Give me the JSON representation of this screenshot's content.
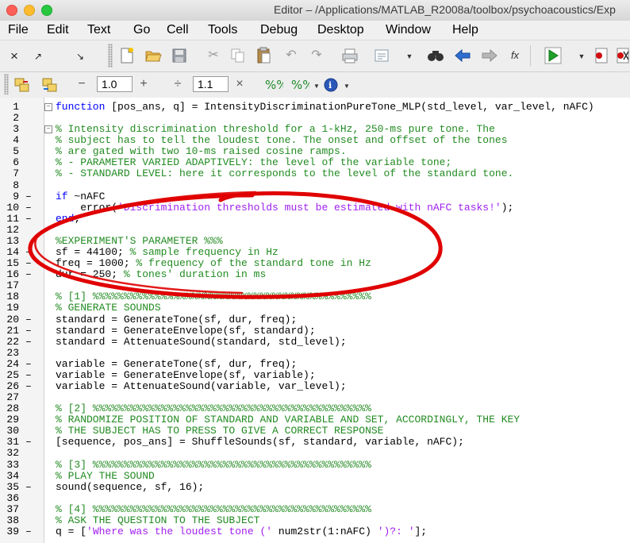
{
  "window": {
    "title": "Editor – /Applications/MATLAB_R2008a/toolbox/psychoacoustics/Exp"
  },
  "menu": [
    "File",
    "Edit",
    "Text",
    "Go",
    "Cell",
    "Tools",
    "Debug",
    "Desktop",
    "Window",
    "Help"
  ],
  "toolbar": {
    "zoom_value_1": "1.0",
    "zoom_value_2": "1.1",
    "minus": "−",
    "plus": "+",
    "divide": "÷",
    "times": "×"
  },
  "code_lines": [
    {
      "n": "1",
      "dash": "",
      "fold": "−",
      "segs": [
        [
          "kw",
          "function"
        ],
        [
          "plain",
          " [pos_ans, q] = IntensityDiscriminationPureTone_MLP(std_level, var_level, nAFC)"
        ]
      ]
    },
    {
      "n": "2",
      "dash": "",
      "fold": "",
      "segs": []
    },
    {
      "n": "3",
      "dash": "",
      "fold": "−",
      "segs": [
        [
          "comment",
          "% Intensity discrimination threshold for a 1-kHz, 250-ms pure tone. The"
        ]
      ]
    },
    {
      "n": "4",
      "dash": "",
      "fold": "",
      "segs": [
        [
          "comment",
          "% subject has to tell the loudest tone. The onset and offset of the tones"
        ]
      ]
    },
    {
      "n": "5",
      "dash": "",
      "fold": "",
      "segs": [
        [
          "comment",
          "% are gated with two 10-ms raised cosine ramps."
        ]
      ]
    },
    {
      "n": "6",
      "dash": "",
      "fold": "",
      "segs": [
        [
          "comment",
          "% - PARAMETER VARIED ADAPTIVELY: the level of the variable tone;"
        ]
      ]
    },
    {
      "n": "7",
      "dash": "",
      "fold": "",
      "segs": [
        [
          "comment",
          "% - STANDARD LEVEL: here it corresponds to the level of the standard tone."
        ]
      ]
    },
    {
      "n": "8",
      "dash": "",
      "fold": "",
      "segs": []
    },
    {
      "n": "9",
      "dash": "–",
      "fold": "",
      "segs": [
        [
          "kw",
          "if"
        ],
        [
          "plain",
          " ~nAFC"
        ]
      ]
    },
    {
      "n": "10",
      "dash": "–",
      "fold": "",
      "segs": [
        [
          "plain",
          "    error("
        ],
        [
          "str",
          "'Discrimination thresholds must be estimated with nAFC tasks!'"
        ],
        [
          "plain",
          ");"
        ]
      ]
    },
    {
      "n": "11",
      "dash": "–",
      "fold": "",
      "segs": [
        [
          "kw",
          "end"
        ],
        [
          "plain",
          ";"
        ]
      ]
    },
    {
      "n": "12",
      "dash": "",
      "fold": "",
      "segs": []
    },
    {
      "n": "13",
      "dash": "",
      "fold": "",
      "segs": [
        [
          "comment",
          "%EXPERIMENT'S PARAMETER %%%"
        ]
      ]
    },
    {
      "n": "14",
      "dash": "–",
      "fold": "",
      "segs": [
        [
          "plain",
          "sf = 44100; "
        ],
        [
          "comment",
          "% sample frequency in Hz"
        ]
      ]
    },
    {
      "n": "15",
      "dash": "–",
      "fold": "",
      "segs": [
        [
          "plain",
          "freq = 1000; "
        ],
        [
          "comment",
          "% frequency of the standard tone in Hz"
        ]
      ]
    },
    {
      "n": "16",
      "dash": "–",
      "fold": "",
      "segs": [
        [
          "plain",
          "dur = 250; "
        ],
        [
          "comment",
          "% tones' duration in ms"
        ]
      ]
    },
    {
      "n": "17",
      "dash": "",
      "fold": "",
      "segs": []
    },
    {
      "n": "18",
      "dash": "",
      "fold": "",
      "segs": [
        [
          "comment",
          "% [1] %%%%%%%%%%%%%%%%%%%%%%%%%%%%%%%%%%%%%%%%%%%%%"
        ]
      ]
    },
    {
      "n": "19",
      "dash": "",
      "fold": "",
      "segs": [
        [
          "comment",
          "% GENERATE SOUNDS"
        ]
      ]
    },
    {
      "n": "20",
      "dash": "–",
      "fold": "",
      "segs": [
        [
          "plain",
          "standard = GenerateTone(sf, dur, freq);"
        ]
      ]
    },
    {
      "n": "21",
      "dash": "–",
      "fold": "",
      "segs": [
        [
          "plain",
          "standard = GenerateEnvelope(sf, standard);"
        ]
      ]
    },
    {
      "n": "22",
      "dash": "–",
      "fold": "",
      "segs": [
        [
          "plain",
          "standard = AttenuateSound(standard, std_level);"
        ]
      ]
    },
    {
      "n": "23",
      "dash": "",
      "fold": "",
      "segs": []
    },
    {
      "n": "24",
      "dash": "–",
      "fold": "",
      "segs": [
        [
          "plain",
          "variable = GenerateTone(sf, dur, freq);"
        ]
      ]
    },
    {
      "n": "25",
      "dash": "–",
      "fold": "",
      "segs": [
        [
          "plain",
          "variable = GenerateEnvelope(sf, variable);"
        ]
      ]
    },
    {
      "n": "26",
      "dash": "–",
      "fold": "",
      "segs": [
        [
          "plain",
          "variable = AttenuateSound(variable, var_level);"
        ]
      ]
    },
    {
      "n": "27",
      "dash": "",
      "fold": "",
      "segs": []
    },
    {
      "n": "28",
      "dash": "",
      "fold": "",
      "segs": [
        [
          "comment",
          "% [2] %%%%%%%%%%%%%%%%%%%%%%%%%%%%%%%%%%%%%%%%%%%%%"
        ]
      ]
    },
    {
      "n": "29",
      "dash": "",
      "fold": "",
      "segs": [
        [
          "comment",
          "% RANDOMIZE POSITION OF STANDARD AND VARIABLE AND SET, ACCORDINGLY, THE KEY"
        ]
      ]
    },
    {
      "n": "30",
      "dash": "",
      "fold": "",
      "segs": [
        [
          "comment",
          "% THE SUBJECT HAS TO PRESS TO GIVE A CORRECT RESPONSE"
        ]
      ]
    },
    {
      "n": "31",
      "dash": "–",
      "fold": "",
      "segs": [
        [
          "plain",
          "[sequence, pos_ans] = ShuffleSounds(sf, standard, variable, nAFC);"
        ]
      ]
    },
    {
      "n": "32",
      "dash": "",
      "fold": "",
      "segs": []
    },
    {
      "n": "33",
      "dash": "",
      "fold": "",
      "segs": [
        [
          "comment",
          "% [3] %%%%%%%%%%%%%%%%%%%%%%%%%%%%%%%%%%%%%%%%%%%%%"
        ]
      ]
    },
    {
      "n": "34",
      "dash": "",
      "fold": "",
      "segs": [
        [
          "comment",
          "% PLAY THE SOUND"
        ]
      ]
    },
    {
      "n": "35",
      "dash": "–",
      "fold": "",
      "segs": [
        [
          "plain",
          "sound(sequence, sf, 16);"
        ]
      ]
    },
    {
      "n": "36",
      "dash": "",
      "fold": "",
      "segs": []
    },
    {
      "n": "37",
      "dash": "",
      "fold": "",
      "segs": [
        [
          "comment",
          "% [4] %%%%%%%%%%%%%%%%%%%%%%%%%%%%%%%%%%%%%%%%%%%%%"
        ]
      ]
    },
    {
      "n": "38",
      "dash": "",
      "fold": "",
      "segs": [
        [
          "comment",
          "% ASK THE QUESTION TO THE SUBJECT"
        ]
      ]
    },
    {
      "n": "39",
      "dash": "–",
      "fold": "",
      "segs": [
        [
          "plain",
          "q = ["
        ],
        [
          "str",
          "'Where was the loudest tone ('"
        ],
        [
          "plain",
          " num2str(1:nAFC) "
        ],
        [
          "str",
          "')?: '"
        ],
        [
          "plain",
          "];"
        ]
      ]
    }
  ],
  "colors": {
    "keyword": "#0000ff",
    "comment": "#228b22",
    "string": "#a020f0",
    "annotation_circle": "#e00000"
  }
}
